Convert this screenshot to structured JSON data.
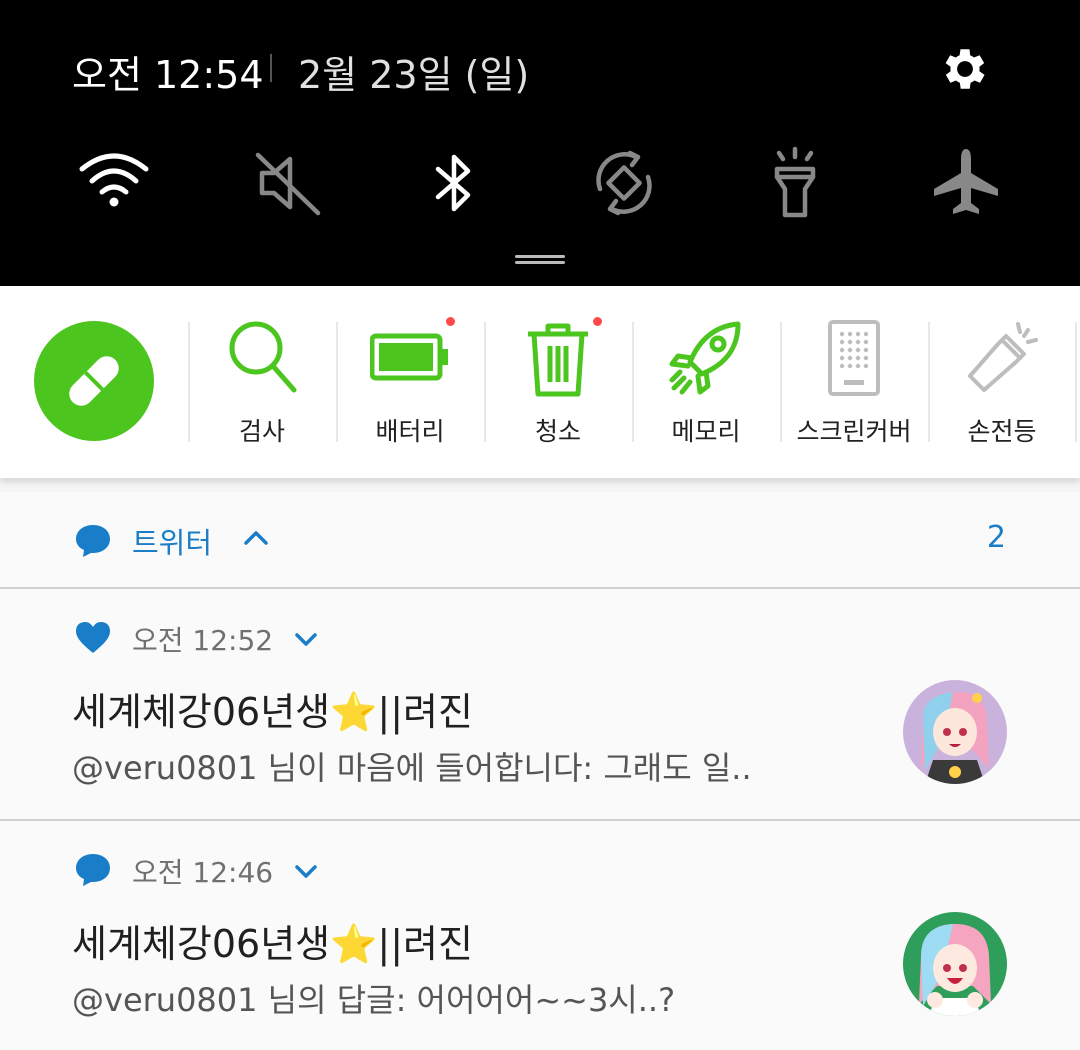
{
  "status": {
    "time": "오전 12:54",
    "date": "2월 23일 (일)"
  },
  "quick_tiles": [
    {
      "icon": "wifi-icon",
      "active": true
    },
    {
      "icon": "sound-mute-icon",
      "active": false
    },
    {
      "icon": "bluetooth-icon",
      "active": true
    },
    {
      "icon": "auto-rotate-icon",
      "active": false
    },
    {
      "icon": "flashlight-icon",
      "active": false
    },
    {
      "icon": "airplane-mode-icon",
      "active": false
    }
  ],
  "app_bar": {
    "boost_icon": "pill-icon",
    "items": [
      {
        "label": "검사",
        "icon": "search-icon",
        "badge": false
      },
      {
        "label": "배터리",
        "icon": "battery-icon",
        "badge": true
      },
      {
        "label": "청소",
        "icon": "trash-icon",
        "badge": true
      },
      {
        "label": "메모리",
        "icon": "rocket-icon",
        "badge": false
      },
      {
        "label": "스크린커버",
        "icon": "phone-screen-icon",
        "badge": false
      },
      {
        "label": "손전등",
        "icon": "flashlight-icon",
        "badge": false
      }
    ]
  },
  "notification_group": {
    "app_name": "트위터",
    "count": "2"
  },
  "notifications": [
    {
      "icon": "heart-icon",
      "time": "오전 12:52",
      "title": "세계체강06년생⭐||려진",
      "text": "@veru0801 님이 마음에 들어합니다: 그래도 일.."
    },
    {
      "icon": "chat-bubble-icon",
      "time": "오전 12:46",
      "title": "세계체강06년생⭐||려진",
      "text": "@veru0801 님의 답글: 어어어어~~3시..?"
    }
  ],
  "colors": {
    "accent_green": "#4cc51f",
    "twitter_blue": "#1a7dc8",
    "badge_red": "#ff4a4a"
  }
}
